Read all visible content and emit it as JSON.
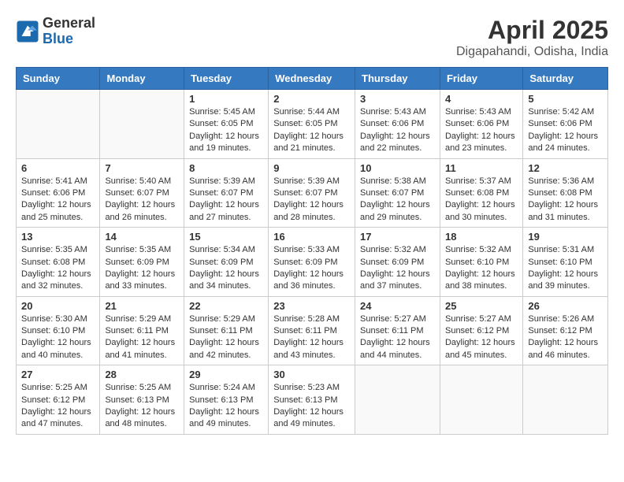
{
  "header": {
    "logo_general": "General",
    "logo_blue": "Blue",
    "month_title": "April 2025",
    "location": "Digapahandi, Odisha, India"
  },
  "weekdays": [
    "Sunday",
    "Monday",
    "Tuesday",
    "Wednesday",
    "Thursday",
    "Friday",
    "Saturday"
  ],
  "weeks": [
    [
      {
        "day": "",
        "info": ""
      },
      {
        "day": "",
        "info": ""
      },
      {
        "day": "1",
        "info": "Sunrise: 5:45 AM\nSunset: 6:05 PM\nDaylight: 12 hours\nand 19 minutes."
      },
      {
        "day": "2",
        "info": "Sunrise: 5:44 AM\nSunset: 6:05 PM\nDaylight: 12 hours\nand 21 minutes."
      },
      {
        "day": "3",
        "info": "Sunrise: 5:43 AM\nSunset: 6:06 PM\nDaylight: 12 hours\nand 22 minutes."
      },
      {
        "day": "4",
        "info": "Sunrise: 5:43 AM\nSunset: 6:06 PM\nDaylight: 12 hours\nand 23 minutes."
      },
      {
        "day": "5",
        "info": "Sunrise: 5:42 AM\nSunset: 6:06 PM\nDaylight: 12 hours\nand 24 minutes."
      }
    ],
    [
      {
        "day": "6",
        "info": "Sunrise: 5:41 AM\nSunset: 6:06 PM\nDaylight: 12 hours\nand 25 minutes."
      },
      {
        "day": "7",
        "info": "Sunrise: 5:40 AM\nSunset: 6:07 PM\nDaylight: 12 hours\nand 26 minutes."
      },
      {
        "day": "8",
        "info": "Sunrise: 5:39 AM\nSunset: 6:07 PM\nDaylight: 12 hours\nand 27 minutes."
      },
      {
        "day": "9",
        "info": "Sunrise: 5:39 AM\nSunset: 6:07 PM\nDaylight: 12 hours\nand 28 minutes."
      },
      {
        "day": "10",
        "info": "Sunrise: 5:38 AM\nSunset: 6:07 PM\nDaylight: 12 hours\nand 29 minutes."
      },
      {
        "day": "11",
        "info": "Sunrise: 5:37 AM\nSunset: 6:08 PM\nDaylight: 12 hours\nand 30 minutes."
      },
      {
        "day": "12",
        "info": "Sunrise: 5:36 AM\nSunset: 6:08 PM\nDaylight: 12 hours\nand 31 minutes."
      }
    ],
    [
      {
        "day": "13",
        "info": "Sunrise: 5:35 AM\nSunset: 6:08 PM\nDaylight: 12 hours\nand 32 minutes."
      },
      {
        "day": "14",
        "info": "Sunrise: 5:35 AM\nSunset: 6:09 PM\nDaylight: 12 hours\nand 33 minutes."
      },
      {
        "day": "15",
        "info": "Sunrise: 5:34 AM\nSunset: 6:09 PM\nDaylight: 12 hours\nand 34 minutes."
      },
      {
        "day": "16",
        "info": "Sunrise: 5:33 AM\nSunset: 6:09 PM\nDaylight: 12 hours\nand 36 minutes."
      },
      {
        "day": "17",
        "info": "Sunrise: 5:32 AM\nSunset: 6:09 PM\nDaylight: 12 hours\nand 37 minutes."
      },
      {
        "day": "18",
        "info": "Sunrise: 5:32 AM\nSunset: 6:10 PM\nDaylight: 12 hours\nand 38 minutes."
      },
      {
        "day": "19",
        "info": "Sunrise: 5:31 AM\nSunset: 6:10 PM\nDaylight: 12 hours\nand 39 minutes."
      }
    ],
    [
      {
        "day": "20",
        "info": "Sunrise: 5:30 AM\nSunset: 6:10 PM\nDaylight: 12 hours\nand 40 minutes."
      },
      {
        "day": "21",
        "info": "Sunrise: 5:29 AM\nSunset: 6:11 PM\nDaylight: 12 hours\nand 41 minutes."
      },
      {
        "day": "22",
        "info": "Sunrise: 5:29 AM\nSunset: 6:11 PM\nDaylight: 12 hours\nand 42 minutes."
      },
      {
        "day": "23",
        "info": "Sunrise: 5:28 AM\nSunset: 6:11 PM\nDaylight: 12 hours\nand 43 minutes."
      },
      {
        "day": "24",
        "info": "Sunrise: 5:27 AM\nSunset: 6:11 PM\nDaylight: 12 hours\nand 44 minutes."
      },
      {
        "day": "25",
        "info": "Sunrise: 5:27 AM\nSunset: 6:12 PM\nDaylight: 12 hours\nand 45 minutes."
      },
      {
        "day": "26",
        "info": "Sunrise: 5:26 AM\nSunset: 6:12 PM\nDaylight: 12 hours\nand 46 minutes."
      }
    ],
    [
      {
        "day": "27",
        "info": "Sunrise: 5:25 AM\nSunset: 6:12 PM\nDaylight: 12 hours\nand 47 minutes."
      },
      {
        "day": "28",
        "info": "Sunrise: 5:25 AM\nSunset: 6:13 PM\nDaylight: 12 hours\nand 48 minutes."
      },
      {
        "day": "29",
        "info": "Sunrise: 5:24 AM\nSunset: 6:13 PM\nDaylight: 12 hours\nand 49 minutes."
      },
      {
        "day": "30",
        "info": "Sunrise: 5:23 AM\nSunset: 6:13 PM\nDaylight: 12 hours\nand 49 minutes."
      },
      {
        "day": "",
        "info": ""
      },
      {
        "day": "",
        "info": ""
      },
      {
        "day": "",
        "info": ""
      }
    ]
  ]
}
